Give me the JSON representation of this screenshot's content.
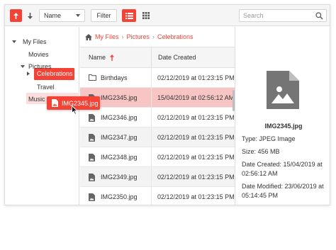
{
  "toolbar": {
    "sort_field": "Name",
    "refresh_label": "Filter",
    "search_placeholder": "Search",
    "accent": "#f44336"
  },
  "tree": {
    "items": [
      {
        "label": "My Files",
        "expanded": true
      },
      {
        "label": "Movies"
      },
      {
        "label": "Pictures",
        "expanded": true
      },
      {
        "label": "Celebrations",
        "selected": true
      },
      {
        "label": "Travel"
      },
      {
        "label": "Music"
      }
    ]
  },
  "drag_ghost": {
    "label": "IMG2345.jpg"
  },
  "breadcrumb": [
    "My Files",
    "Pictures",
    "Celebrations"
  ],
  "grid": {
    "headers": {
      "name": "Name",
      "date": "Date Created"
    },
    "rows": [
      {
        "name": "Birthdays",
        "date": "02/12/2019 at 01:23:15 PM",
        "type": "folder"
      },
      {
        "name": "IMG2345.jpg",
        "date": "15/04/2019 at 02:56:12 AM",
        "type": "image",
        "selected": true
      },
      {
        "name": "IMG2346.jpg",
        "date": "02/12/2019 at 01:23:15 PM",
        "type": "image"
      },
      {
        "name": "IMG2347.jpg",
        "date": "02/12/2019 at 01:23:15 PM",
        "type": "image"
      },
      {
        "name": "IMG2348.jpg",
        "date": "02/12/2019 at 01:23:15 PM",
        "type": "image"
      },
      {
        "name": "IMG2349.jpg",
        "date": "02/12/2019 at 01:23:15 PM",
        "type": "image"
      },
      {
        "name": "IMG2350.jpg",
        "date": "02/12/2019 at 01:23:15 PM",
        "type": "image"
      }
    ]
  },
  "preview": {
    "name": "IMG2345.jpg",
    "type": "Type: JPEG Image",
    "size": "Size: 456 MB",
    "created_1": "Date Created: 15/04/2019 at",
    "created_2": "02:56:12 AM",
    "modified_1": "Date Modified: 23/06/2019 at",
    "modified_2": "05:14:45 PM"
  }
}
